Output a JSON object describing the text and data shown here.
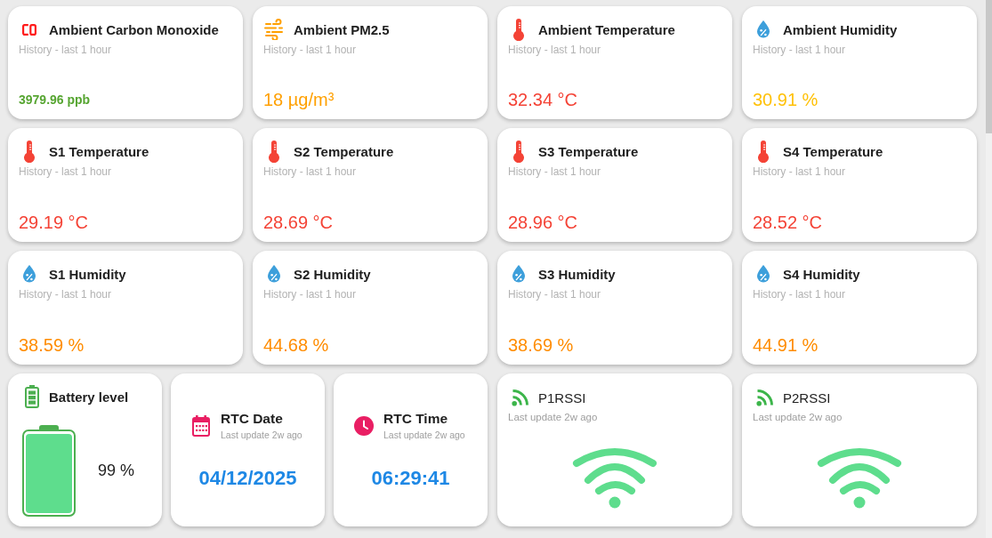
{
  "sensor_cards": [
    {
      "kind": "co",
      "title": "Ambient Carbon Monoxide",
      "subtitle": "History - last 1 hour",
      "value": "3979.96 ppb",
      "color": "#56a531"
    },
    {
      "kind": "dust",
      "title": "Ambient PM2.5",
      "subtitle": "History - last 1 hour",
      "value": "18 µg/m³",
      "color": "#ffa000"
    },
    {
      "kind": "thermometer",
      "title": "Ambient Temperature",
      "subtitle": "History - last 1 hour",
      "value": "32.34 °C",
      "color": "#f44336"
    },
    {
      "kind": "humidity",
      "title": "Ambient Humidity",
      "subtitle": "History - last 1 hour",
      "value": "30.91 %",
      "color": "#ffc107"
    },
    {
      "kind": "thermometer",
      "title": "S1 Temperature",
      "subtitle": "History - last 1 hour",
      "value": "29.19 °C",
      "color": "#f44336"
    },
    {
      "kind": "thermometer",
      "title": "S2 Temperature",
      "subtitle": "History - last 1 hour",
      "value": "28.69 °C",
      "color": "#f44336"
    },
    {
      "kind": "thermometer",
      "title": "S3 Temperature",
      "subtitle": "History - last 1 hour",
      "value": "28.96 °C",
      "color": "#f44336"
    },
    {
      "kind": "thermometer",
      "title": "S4 Temperature",
      "subtitle": "History - last 1 hour",
      "value": "28.52 °C",
      "color": "#f44336"
    },
    {
      "kind": "humidity",
      "title": "S1 Humidity",
      "subtitle": "History - last 1 hour",
      "value": "38.59 %",
      "color": "#ff8c00"
    },
    {
      "kind": "humidity",
      "title": "S2 Humidity",
      "subtitle": "History - last 1 hour",
      "value": "44.68 %",
      "color": "#ff8c00"
    },
    {
      "kind": "humidity",
      "title": "S3 Humidity",
      "subtitle": "History - last 1 hour",
      "value": "38.69 %",
      "color": "#ff8c00"
    },
    {
      "kind": "humidity",
      "title": "S4 Humidity",
      "subtitle": "History - last 1 hour",
      "value": "44.91 %",
      "color": "#ff8c00"
    }
  ],
  "battery_card": {
    "title": "Battery level",
    "level": 0.99,
    "reading": "99 %"
  },
  "rtc_cards": [
    {
      "kind": "date",
      "title": "RTC Date",
      "subtitle": "Last update 2w ago",
      "value": "04/12/2025"
    },
    {
      "kind": "time",
      "title": "RTC Time",
      "subtitle": "Last update 2w ago",
      "value": "06:29:41"
    }
  ],
  "signal_cards": [
    {
      "title": "P1RSSI",
      "subtitle": "Last update 2w ago"
    },
    {
      "title": "P2RSSI",
      "subtitle": "Last update 2w ago"
    }
  ]
}
